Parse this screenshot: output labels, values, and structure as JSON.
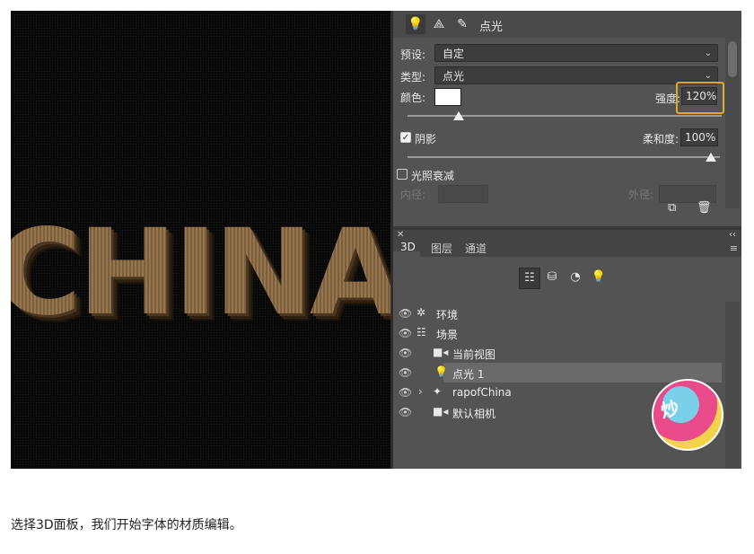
{
  "canvas": {
    "text": "CHINA"
  },
  "properties_panel": {
    "toolbar_title": "点光",
    "icons": [
      "bulb-icon",
      "transform-icon",
      "brush-icon"
    ],
    "preset": {
      "label": "预设:",
      "value": "自定"
    },
    "type": {
      "label": "类型:",
      "value": "点光"
    },
    "color": {
      "label": "颜色:",
      "value": "#ffffff"
    },
    "intensity": {
      "label": "强度:",
      "value": "120%",
      "level": 0.14
    },
    "shadow": {
      "label": "阴影",
      "checked": true,
      "softness_label": "柔和度:",
      "softness_value": "100%",
      "level": 1.0
    },
    "falloff": {
      "label": "光照衰减",
      "checked": false,
      "inner_label": "内径:",
      "outer_label": "外径:"
    }
  },
  "layers_panel": {
    "tabs": [
      "3D",
      "图层",
      "通道"
    ],
    "active_tab": "3D",
    "filter_icons": [
      "scene-filter-icon",
      "mesh-filter-icon",
      "material-filter-icon",
      "light-filter-icon"
    ],
    "items": [
      {
        "label": "环境",
        "icon": "environment-icon",
        "visible": true
      },
      {
        "label": "场景",
        "icon": "scene-icon",
        "visible": true
      },
      {
        "label": "当前视图",
        "icon": "camera-icon",
        "visible": true
      },
      {
        "label": "点光 1",
        "icon": "bulb-icon",
        "visible": true,
        "selected": true
      },
      {
        "label": "rapofChina",
        "icon": "mesh-icon",
        "visible": true,
        "expandable": true
      },
      {
        "label": "默认相机",
        "icon": "camera-icon",
        "visible": true
      }
    ]
  },
  "caption": "选择3D面板，我们开始字体的材质编辑。"
}
